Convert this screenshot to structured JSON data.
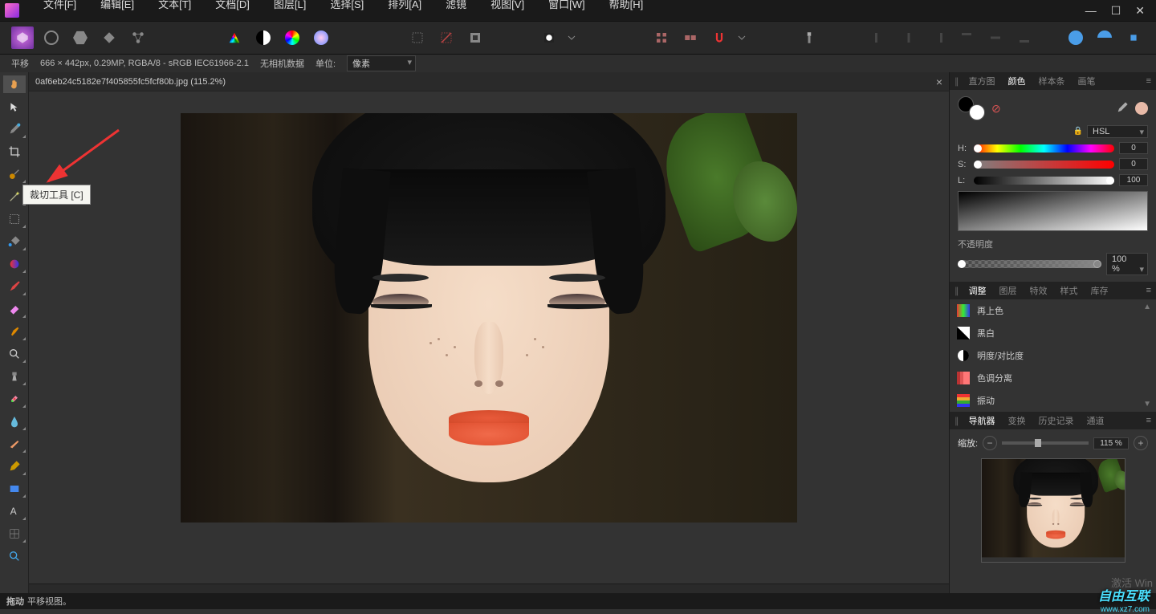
{
  "menubar": {
    "items": [
      "文件[F]",
      "编辑[E]",
      "文本[T]",
      "文档[D]",
      "图层[L]",
      "选择[S]",
      "排列[A]",
      "滤镜",
      "视图[V]",
      "窗口[W]",
      "帮助[H]"
    ]
  },
  "window_controls": {
    "min": "—",
    "max": "☐",
    "close": "✕"
  },
  "contextbar": {
    "tool": "平移",
    "info": "666 × 442px, 0.29MP, RGBA/8 - sRGB IEC61966-2.1",
    "cameradata": "无相机数据",
    "unit_label": "单位:",
    "unit_value": "像素"
  },
  "document": {
    "tab_title": "0af6eb24c5182e7f405855fc5fcf80b.jpg (115.2%)",
    "close": "×"
  },
  "tooltip": {
    "text": "裁切工具 [C]"
  },
  "panels": {
    "group1_tabs": [
      "直方图",
      "颜色",
      "样本条",
      "画笔"
    ],
    "group1_active": 1,
    "color": {
      "mode": "HSL",
      "h_label": "H:",
      "s_label": "S:",
      "l_label": "L:",
      "h_val": "0",
      "s_val": "0",
      "l_val": "100",
      "opacity_label": "不透明度",
      "opacity_val": "100 %"
    },
    "group2_tabs": [
      "调整",
      "图层",
      "特效",
      "样式",
      "库存"
    ],
    "group2_active": 0,
    "adjustments": [
      "再上色",
      "黑白",
      "明度/对比度",
      "色调分离",
      "振动"
    ],
    "group3_tabs": [
      "导航器",
      "变换",
      "历史记录",
      "通道"
    ],
    "group3_active": 0,
    "navigator": {
      "zoom_label": "缩放:",
      "zoom_val": "115 %"
    }
  },
  "statusbar": {
    "action": "拖动",
    "desc": "平移视图。"
  },
  "watermark": {
    "brand": "自由互联",
    "url": "www.xz7.com"
  },
  "activate_text": "激活 Win"
}
